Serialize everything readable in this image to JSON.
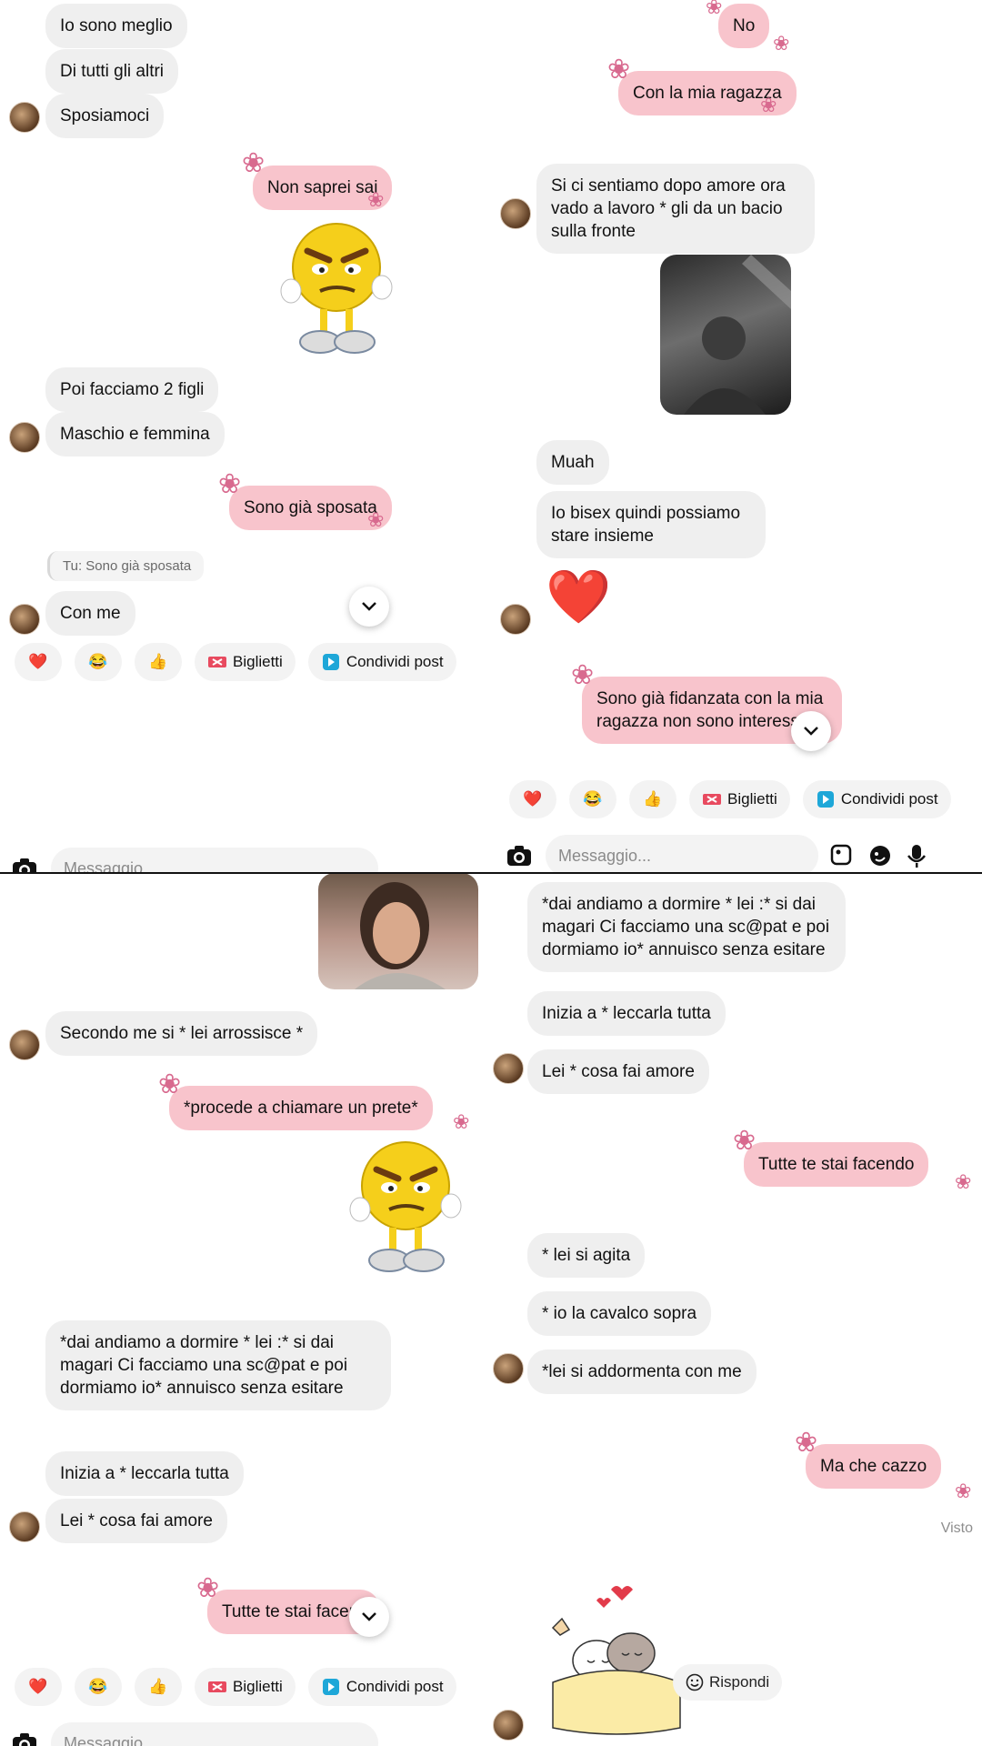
{
  "panel1": {
    "messages": {
      "m1": "Io sono meglio",
      "m2": "Di tutti gli altri",
      "m3": "Sposiamoci",
      "m4": "Non saprei sai",
      "m5": "Poi facciamo 2 figli",
      "m6": "Maschio e femmina",
      "m7": "Sono già sposata",
      "reply_preview": "Tu: Sono già sposata",
      "m8": "Con me"
    }
  },
  "panel2": {
    "messages": {
      "m1": "No",
      "m2": "Con la mia ragazza",
      "m3": "Si ci sentiamo dopo amore ora vado a lavoro * gli da un bacio sulla fronte",
      "m4": "Muah",
      "m5": "Io bisex quindi possiamo stare insieme",
      "m6": "Sono già fidanzata con la mia ragazza non sono interessata"
    }
  },
  "panel3": {
    "messages": {
      "m1": "Secondo me si * lei arrossisce *",
      "m2": "*procede a chiamare un prete*",
      "m3": "*dai andiamo a dormire * lei :* si dai magari Ci facciamo una sc@pat e poi dormiamo io* annuisco senza esitare",
      "m4": "Inizia a * leccarla tutta",
      "m5": "Lei * cosa fai amore",
      "m6": "Tutte te stai facen"
    }
  },
  "panel4": {
    "messages": {
      "m1": "*dai andiamo a dormire * lei :* si dai magari Ci facciamo una sc@pat e poi dormiamo io* annuisco senza esitare",
      "m2": "Inizia a * leccarla tutta",
      "m3": "Lei * cosa fai amore",
      "m4": "Tutte te stai facendo",
      "m5": "* lei si agita",
      "m6": "* io la cavalco sopra",
      "m7": "*lei si addormenta con me",
      "m8": "Ma che cazzo"
    },
    "seen": "Visto",
    "reply_button": "Rispondi"
  },
  "quick_replies": {
    "heart": "❤️",
    "laugh": "😂",
    "thumbs": "👍",
    "tickets": "Biglietti",
    "share": "Condividi post"
  },
  "composer": {
    "placeholder": "Messaggio..."
  },
  "icons": {
    "flower": "❀",
    "heart_big": "❤️"
  },
  "colors": {
    "outgoing_bubble": "#f8c4cc",
    "incoming_bubble": "#efefef",
    "flower": "#d86a8f"
  }
}
